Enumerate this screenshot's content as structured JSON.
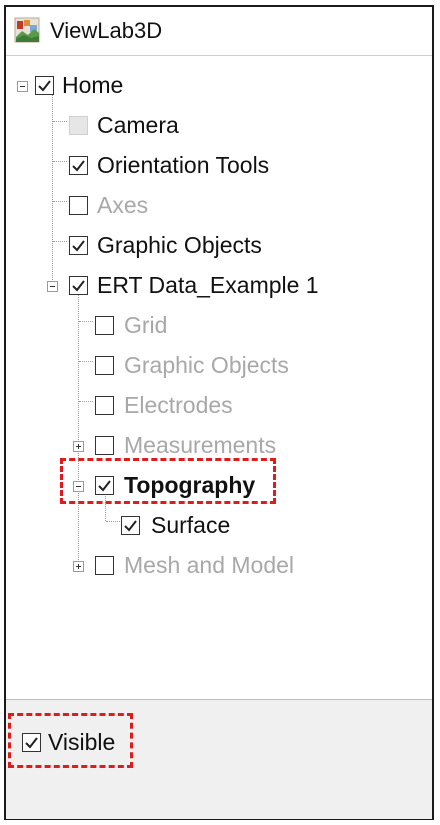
{
  "window": {
    "title": "ViewLab3D",
    "app_icon": "viewlab3d-app-icon"
  },
  "tree": {
    "home": {
      "label": "Home",
      "checked": true,
      "expanded": true
    },
    "camera": {
      "label": "Camera",
      "checked": false,
      "enabled": false
    },
    "orientation_tools": {
      "label": "Orientation Tools",
      "checked": true
    },
    "axes": {
      "label": "Axes",
      "checked": false
    },
    "graphic_objects": {
      "label": "Graphic Objects",
      "checked": true
    },
    "ert_data": {
      "label": "ERT Data_Example 1",
      "checked": true,
      "expanded": true
    },
    "grid": {
      "label": "Grid",
      "checked": false
    },
    "ert_graphic_objects": {
      "label": "Graphic Objects",
      "checked": false
    },
    "electrodes": {
      "label": "Electrodes",
      "checked": false
    },
    "measurements": {
      "label": "Measurements",
      "checked": false,
      "expanded": false
    },
    "topography": {
      "label": "Topography",
      "checked": true,
      "expanded": true,
      "selected": true
    },
    "surface": {
      "label": "Surface",
      "checked": true
    },
    "mesh_and_model": {
      "label": "Mesh and Model",
      "checked": false,
      "expanded": false
    }
  },
  "properties": {
    "visible_label": "Visible",
    "visible_checked": true
  },
  "colors": {
    "highlight": "#e01b1b",
    "disabled_text": "#a8a8a8",
    "panel_bg": "#f0f0f0"
  }
}
